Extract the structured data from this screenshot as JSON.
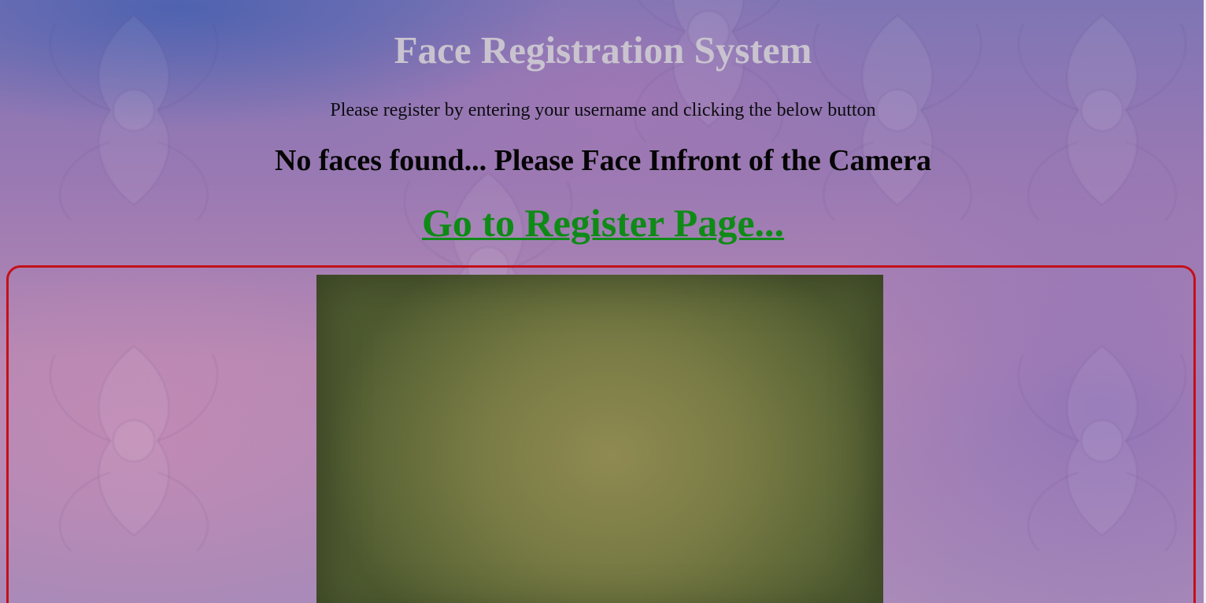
{
  "page": {
    "title": "Face Registration System",
    "instruction": "Please register by entering your username and clicking the below button",
    "status_message": "No faces found... Please Face Infront of the Camera",
    "register_link_label": "Go to Register Page..."
  },
  "camera": {
    "icon": "webcam-feed"
  },
  "colors": {
    "title": "#c9c3cf",
    "link": "#0f8a17",
    "camera_border": "#c4101a"
  }
}
